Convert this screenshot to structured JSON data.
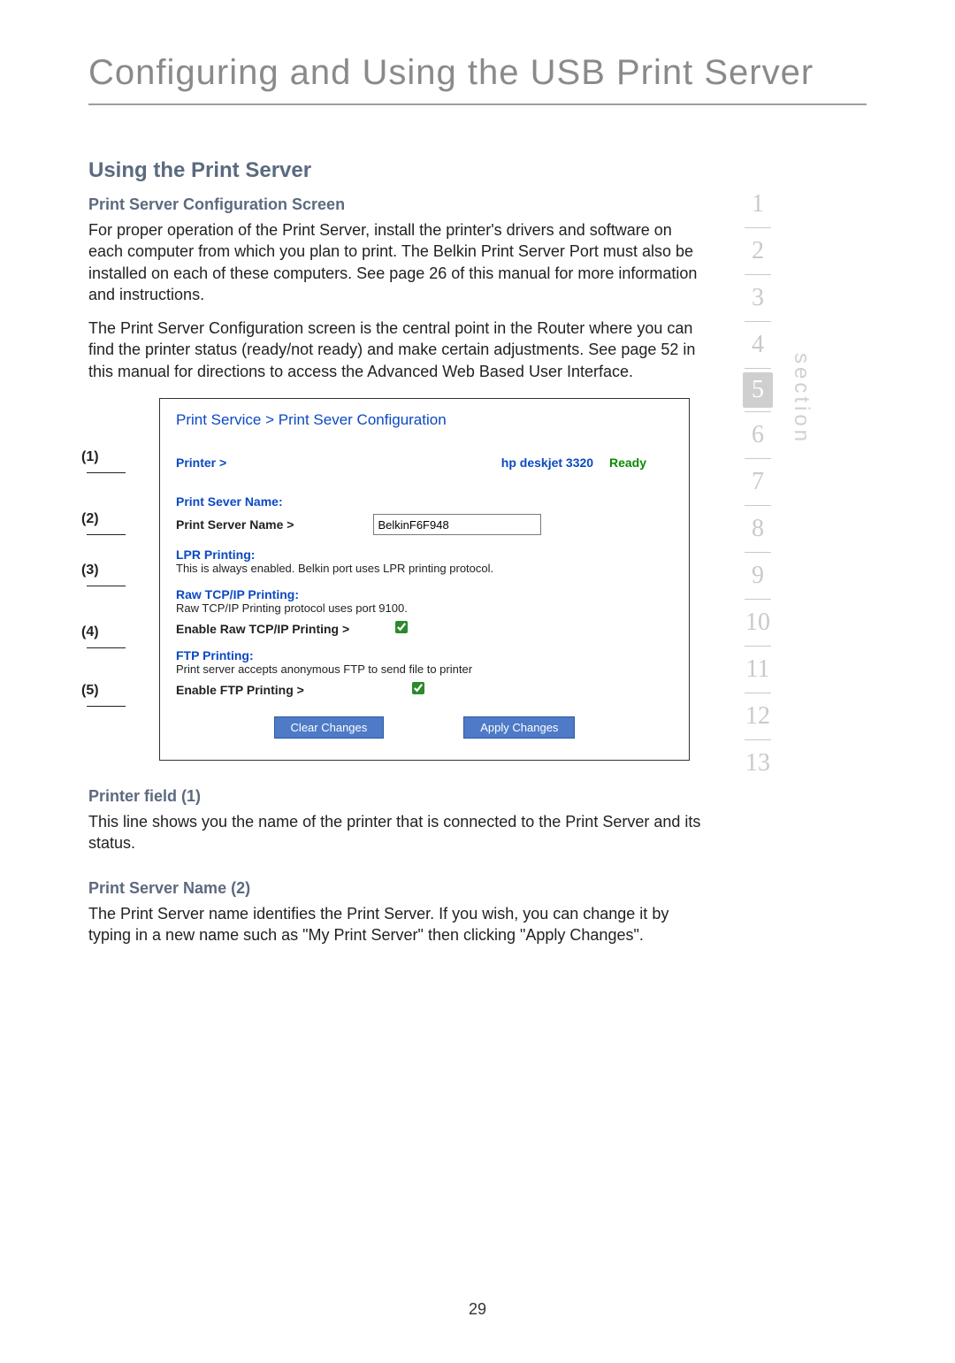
{
  "title": "Configuring and Using the USB Print Server",
  "h2": "Using the Print Server",
  "h3a": "Print Server Configuration Screen",
  "p1": "For proper operation of the Print Server, install the printer's drivers and software on each computer from which you plan to print. The Belkin Print Server Port must also be installed on each of these computers. See page 26 of this manual for more information and instructions.",
  "p2": "The Print Server Configuration screen is the central point in the Router where you can find the printer status (ready/not ready) and make certain adjustments. See page 52 in this manual for directions to access the Advanced Web Based User Interface.",
  "markers": {
    "m1": "(1)",
    "m2": "(2)",
    "m3": "(3)",
    "m4": "(4)",
    "m5": "(5)"
  },
  "shot": {
    "breadcrumb": "Print Service > Print Sever Configuration",
    "printer_label": "Printer >",
    "printer_name": "hp deskjet 3320",
    "printer_status": "Ready",
    "psn_head": "Print Sever Name:",
    "psn_label": "Print Server Name >",
    "psn_value": "BelkinF6F948",
    "lpr_head": "LPR Printing:",
    "lpr_desc": "This is always enabled. Belkin port uses LPR printing protocol.",
    "raw_head": "Raw TCP/IP Printing:",
    "raw_desc": "Raw TCP/IP Printing protocol uses port 9100.",
    "raw_enable": "Enable Raw TCP/IP Printing >",
    "ftp_head": "FTP Printing:",
    "ftp_desc": "Print server accepts anonymous FTP to send file to printer",
    "ftp_enable": "Enable FTP Printing >",
    "clear": "Clear Changes",
    "apply": "Apply Changes"
  },
  "h3b": "Printer field (1)",
  "p3": "This line shows you the name of the printer that is connected to the Print Server and its status.",
  "h3c": "Print Server Name (2)",
  "p4": "The Print Server name identifies the Print Server. If you wish, you can change it by typing in a new name such as \"My Print Server\" then clicking \"Apply Changes\".",
  "sidebar": {
    "nums": [
      "1",
      "2",
      "3",
      "4",
      "5",
      "6",
      "7",
      "8",
      "9",
      "10",
      "11",
      "12",
      "13"
    ],
    "active_index": 4,
    "label": "section"
  },
  "page_number": "29"
}
